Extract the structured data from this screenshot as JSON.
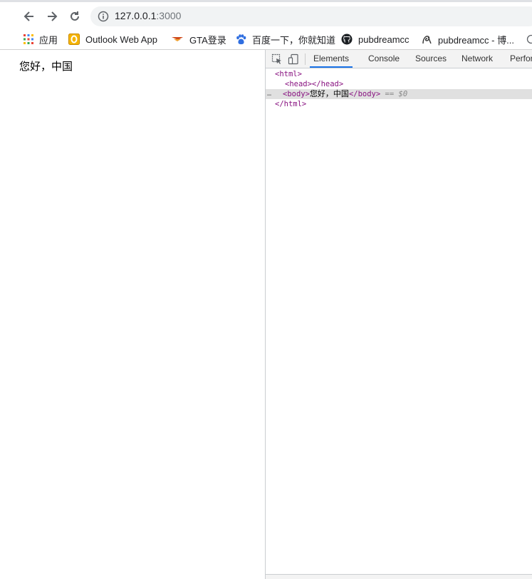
{
  "browser": {
    "url_host": "127.0.0.1",
    "url_port": ":3000"
  },
  "bookmarks": [
    {
      "label": "应用",
      "icon": "apps-grid-icon"
    },
    {
      "label": "Outlook Web App",
      "icon": "outlook-icon"
    },
    {
      "label": "GTA登录",
      "icon": "gta-icon"
    },
    {
      "label": "百度一下，你就知道",
      "icon": "baidu-paw-icon"
    },
    {
      "label": "pubdreamcc",
      "icon": "github-icon"
    },
    {
      "label": "pubdreamcc - 博...",
      "icon": "blog-icon"
    }
  ],
  "page": {
    "body_text": "您好，中国"
  },
  "devtools": {
    "tabs": [
      "Elements",
      "Console",
      "Sources",
      "Network",
      "Perfor"
    ],
    "active_tab": "Elements",
    "dom": {
      "html_open": "<html>",
      "head": "<head></head>",
      "body_open": "<body>",
      "body_text": "您好，中国",
      "body_close": "</body>",
      "selected_marker": "== $0",
      "html_close": "</html>",
      "ellipsis": "…"
    }
  },
  "colors": {
    "tab_underline": "#1a73e8",
    "tag": "#881280",
    "selected_row": "#e0e0e0"
  }
}
